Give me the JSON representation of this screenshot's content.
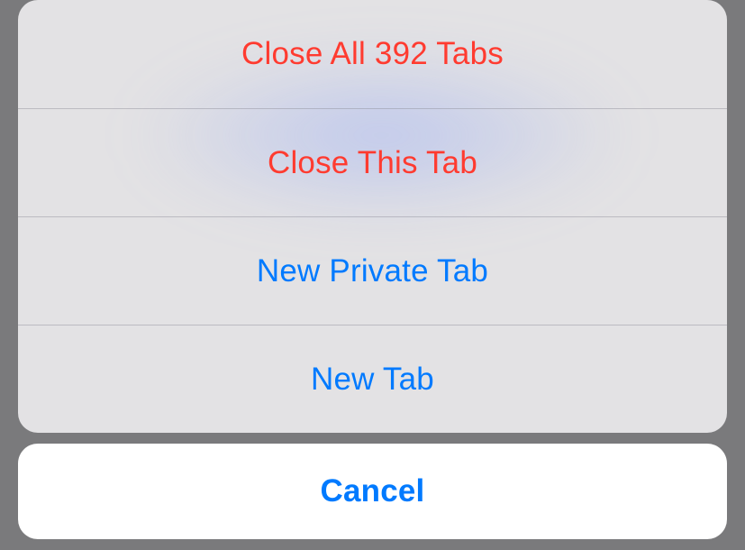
{
  "action_sheet": {
    "options": [
      {
        "label": "Close All 392 Tabs",
        "style": "destructive"
      },
      {
        "label": "Close This Tab",
        "style": "destructive"
      },
      {
        "label": "New Private Tab",
        "style": "default"
      },
      {
        "label": "New Tab",
        "style": "default"
      }
    ],
    "cancel_label": "Cancel"
  }
}
